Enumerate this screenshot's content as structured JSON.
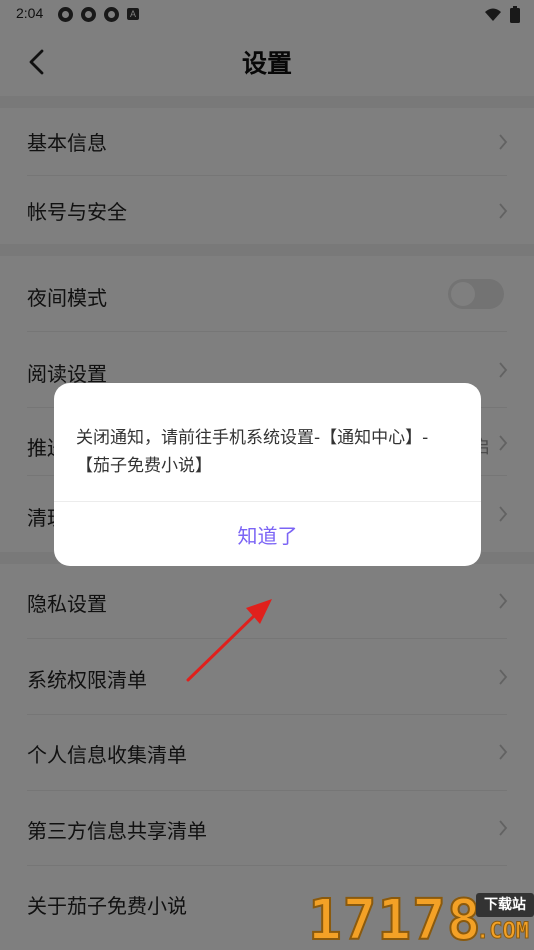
{
  "status_bar": {
    "time": "2:04",
    "left_icons": [
      "app-notification-icon",
      "app-notification-icon",
      "app-notification-icon",
      "a-letter-icon"
    ],
    "right_icons": [
      "wifi-icon",
      "battery-icon"
    ]
  },
  "header": {
    "title": "设置"
  },
  "sections": [
    {
      "items": [
        {
          "label": "基本信息"
        },
        {
          "label": "帐号与安全"
        }
      ]
    },
    {
      "items": [
        {
          "label": "夜间模式",
          "toggle_on": false
        },
        {
          "label": "阅读设置"
        },
        {
          "label": "推送",
          "extra": "启"
        },
        {
          "label": "清理"
        }
      ]
    },
    {
      "items": [
        {
          "label": "隐私设置"
        },
        {
          "label": "系统权限清单"
        },
        {
          "label": "个人信息收集清单"
        },
        {
          "label": "第三方信息共享清单"
        },
        {
          "label": "关于茄子免费小说"
        }
      ]
    }
  ],
  "dialog": {
    "message": "关闭通知，请前往手机系统设置-【通知中心】-【茄子免费小说】",
    "confirm_label": "知道了"
  },
  "watermark": {
    "digits": "17178",
    "badge": "下载站",
    "domain": ".COM"
  },
  "colors": {
    "accent": "#7b64f5",
    "overlay": "rgba(0,0,0,0.5)",
    "arrow": "#e0201c"
  }
}
